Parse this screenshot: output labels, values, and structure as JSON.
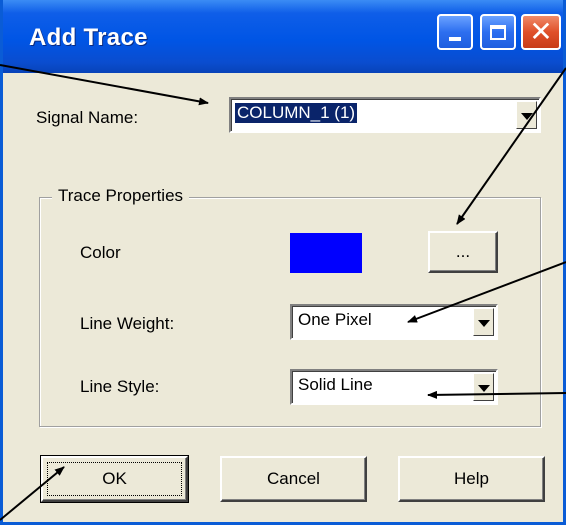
{
  "window": {
    "title": "Add Trace"
  },
  "signal": {
    "label": "Signal Name:",
    "value": "COLUMN_1 (1)"
  },
  "trace_properties": {
    "legend": "Trace Properties",
    "color": {
      "label": "Color",
      "swatch": "#0000ff",
      "button_label": "..."
    },
    "line_weight": {
      "label": "Line Weight:",
      "value": "One Pixel"
    },
    "line_style": {
      "label": "Line Style:",
      "value": "Solid Line"
    }
  },
  "buttons": {
    "ok": "OK",
    "cancel": "Cancel",
    "help": "Help"
  },
  "colors": {
    "titlebar": "#0055e5",
    "dialog_bg": "#ece9d8",
    "selection": "#0a246a"
  }
}
